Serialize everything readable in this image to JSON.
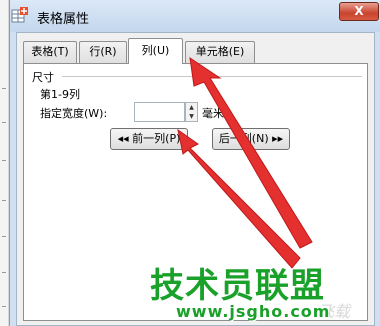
{
  "dialog": {
    "title": "表格属性",
    "close_label": "X"
  },
  "tabs": [
    {
      "label": "表格(T)",
      "active": false
    },
    {
      "label": "行(R)",
      "active": false
    },
    {
      "label": "列(U)",
      "active": true
    },
    {
      "label": "单元格(E)",
      "active": false
    }
  ],
  "column_tab": {
    "group_label": "尺寸",
    "range_label": "第1-9列",
    "width_label": "指定宽度(W):",
    "width_value": "",
    "unit_label": "毫米",
    "prev_button": "◂◂ 前一列(P)",
    "next_button": "后一列(N) ▸▸"
  },
  "watermark": {
    "brand": "技术员联盟",
    "url": "www.jsgho.com",
    "faint": "飞载"
  },
  "colors": {
    "titlebar": "#c4d7ee",
    "close_button": "#c8442e",
    "arrow": "#e53030",
    "watermark": "#1aa12a"
  },
  "icons": [
    "table-properties-app-icon",
    "spin-up-icon",
    "spin-down-icon",
    "dropdown-arrow-icon"
  ]
}
